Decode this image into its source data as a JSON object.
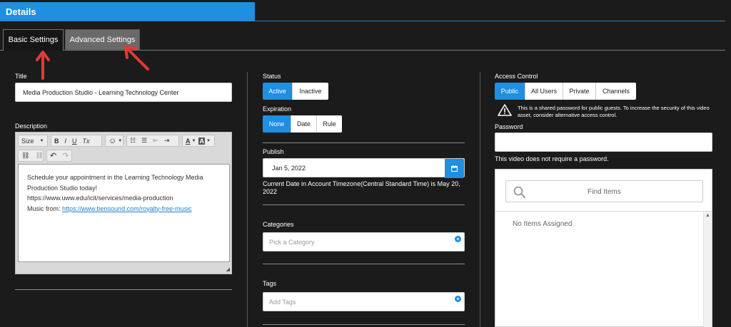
{
  "header": {
    "title": "Details"
  },
  "tabs": [
    {
      "label": "Basic Settings",
      "active": true
    },
    {
      "label": "Advanced Settings",
      "active": false
    }
  ],
  "left": {
    "title_label": "Title",
    "title_value": "Media Production Studio - Learning Technology Center",
    "description_label": "Description",
    "toolbar": {
      "size_label": "Size",
      "bold": "B",
      "italic": "I",
      "underline": "U",
      "clear_format": "Tx",
      "text_color": "A",
      "bg_color": "A"
    },
    "description_lines": [
      "Schedule your appointment in the Learning Technology Media",
      "Production Studio today!",
      "https://www.uww.edu/icit/services/media-production"
    ],
    "music_prefix": "Music from: ",
    "music_link": "https://www.bensound.com/royalty-free-music"
  },
  "middle": {
    "status_label": "Status",
    "status_options": [
      "Active",
      "Inactive"
    ],
    "status_selected": "Active",
    "expiration_label": "Expiration",
    "expiration_options": [
      "None",
      "Date",
      "Rule"
    ],
    "expiration_selected": "None",
    "publish_label": "Publish",
    "publish_value": "Jan 5, 2022",
    "publish_note": "Current Date in Account Timezone(Central Standard Time) is May 20, 2022",
    "categories_label": "Categories",
    "categories_placeholder": "Pick a Category",
    "tags_label": "Tags",
    "tags_placeholder": "Add Tags"
  },
  "right": {
    "access_label": "Access Control",
    "access_options": [
      "Public",
      "All Users",
      "Private",
      "Channels"
    ],
    "access_selected": "Public",
    "warning_text": "This is a shared password for public guests. To increase the security of this video asset, consider alternative access control.",
    "password_label": "Password",
    "password_value": "",
    "password_note": "This video does not require a password.",
    "find_placeholder": "Find Items",
    "no_items": "No Items Assigned"
  },
  "colors": {
    "accent": "#1e8fe1",
    "background": "#1b1b1b",
    "annotation_arrow": "#e53935"
  }
}
